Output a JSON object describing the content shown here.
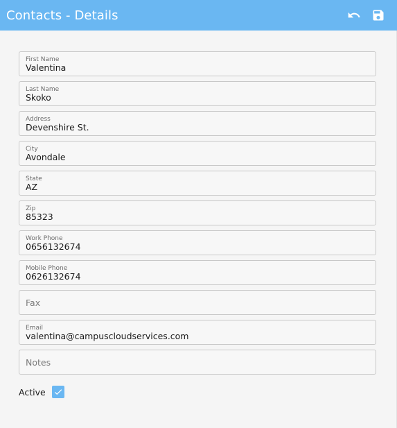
{
  "header": {
    "title": "Contacts - Details",
    "undo_icon": "undo-icon",
    "save_icon": "save-icon",
    "color": "#6ab7f2"
  },
  "fields": {
    "first_name": {
      "label": "First Name",
      "value": "Valentina"
    },
    "last_name": {
      "label": "Last Name",
      "value": "Skoko"
    },
    "address": {
      "label": "Address",
      "value": "Devenshire St."
    },
    "city": {
      "label": "City",
      "value": "Avondale"
    },
    "state": {
      "label": "State",
      "value": "AZ"
    },
    "zip": {
      "label": "Zip",
      "value": "85323"
    },
    "work_phone": {
      "label": "Work Phone",
      "value": "0656132674"
    },
    "mobile_phone": {
      "label": "Mobile Phone",
      "value": "0626132674"
    },
    "fax": {
      "placeholder": "Fax",
      "value": ""
    },
    "email": {
      "label": "Email",
      "value": "valentina@campuscloudservices.com"
    },
    "notes": {
      "placeholder": "Notes",
      "value": ""
    }
  },
  "active": {
    "label": "Active",
    "checked": true
  }
}
